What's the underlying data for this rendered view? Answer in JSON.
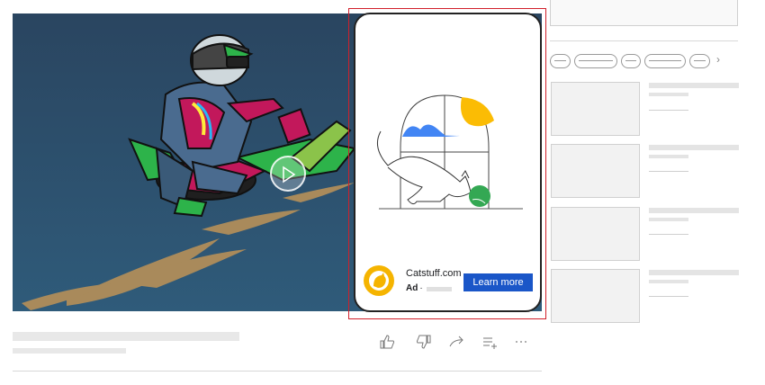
{
  "ad": {
    "advertiser": "Catstuff.com",
    "label": "Ad",
    "separator": "·",
    "cta": "Learn more",
    "colors": {
      "cta": "#1a56c8",
      "logo": "#f5b400",
      "highlight": "#d11f2a"
    }
  },
  "video": {
    "play_icon": "play-icon"
  },
  "actions": [
    {
      "name": "like-icon",
      "glyph": "👍"
    },
    {
      "name": "dislike-icon",
      "glyph": "👎"
    },
    {
      "name": "share-icon",
      "glyph": "↪"
    },
    {
      "name": "save-to-playlist-icon",
      "glyph": "≡+"
    },
    {
      "name": "more-icon",
      "glyph": "···"
    }
  ],
  "sidebar": {
    "chip_next": "›"
  }
}
